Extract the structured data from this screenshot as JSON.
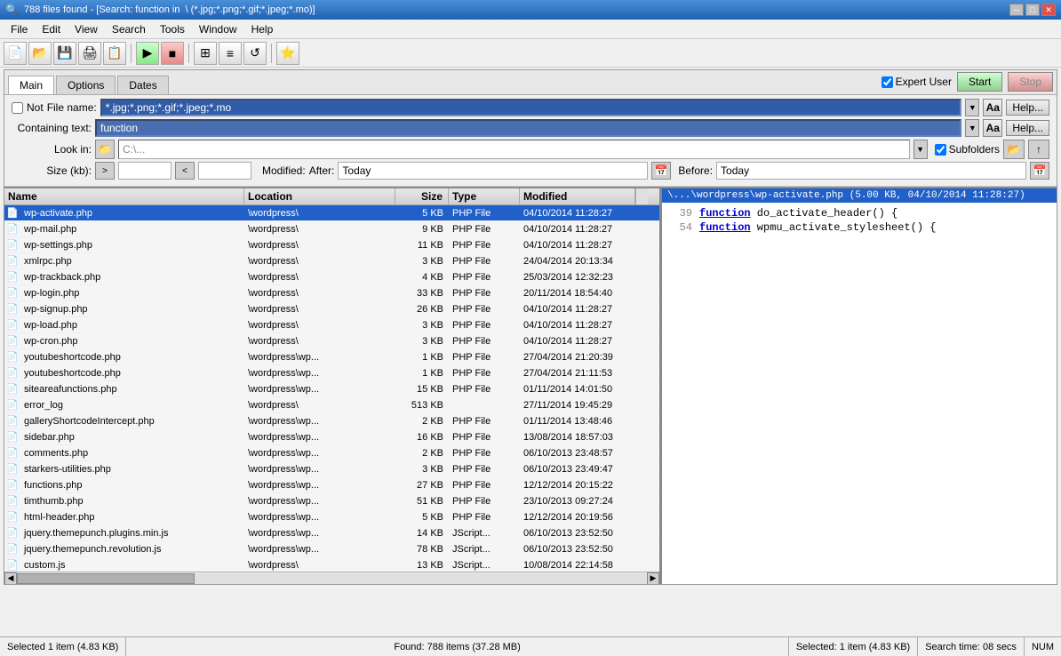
{
  "window": {
    "title": "788 files found - [Search: function in",
    "title_suffix": " \\ (*.jpg;*.png;*.gif;*.jpeg;*.mo)]"
  },
  "menu": {
    "items": [
      "File",
      "Edit",
      "View",
      "Search",
      "Tools",
      "Window",
      "Help"
    ]
  },
  "tabs": {
    "items": [
      "Main",
      "Options",
      "Dates"
    ],
    "active": "Main"
  },
  "header": {
    "expert_user_label": "Expert User",
    "start_label": "Start",
    "stop_label": "Stop"
  },
  "search_form": {
    "not_label": "Not",
    "file_name_label": "File name:",
    "file_name_value": "*.jpg;*.png;*.gif;*.jpeg;*.mo",
    "containing_label": "Containing text:",
    "containing_value": "function",
    "look_in_label": "Look in:",
    "look_in_value": "C:\\...",
    "subfolders_label": "Subfolders",
    "size_label": "Size (kb):",
    "size_from": "",
    "size_to": "",
    "modified_label": "Modified:",
    "after_label": "After:",
    "after_value": "Today",
    "before_label": "Before:",
    "before_value": "Today"
  },
  "file_list": {
    "columns": [
      "Name",
      "Location",
      "Size",
      "Type",
      "Modified"
    ],
    "rows": [
      {
        "name": "wp-activate.php",
        "location": "\\wordpress\\",
        "size": "5 KB",
        "type": "PHP File",
        "modified": "04/10/2014 11:28:27",
        "selected": true
      },
      {
        "name": "wp-mail.php",
        "location": "\\wordpress\\",
        "size": "9 KB",
        "type": "PHP File",
        "modified": "04/10/2014 11:28:27",
        "selected": false
      },
      {
        "name": "wp-settings.php",
        "location": "\\wordpress\\",
        "size": "11 KB",
        "type": "PHP File",
        "modified": "04/10/2014 11:28:27",
        "selected": false
      },
      {
        "name": "xmlrpc.php",
        "location": "\\wordpress\\",
        "size": "3 KB",
        "type": "PHP File",
        "modified": "24/04/2014 20:13:34",
        "selected": false
      },
      {
        "name": "wp-trackback.php",
        "location": "\\wordpress\\",
        "size": "4 KB",
        "type": "PHP File",
        "modified": "25/03/2014 12:32:23",
        "selected": false
      },
      {
        "name": "wp-login.php",
        "location": "\\wordpress\\",
        "size": "33 KB",
        "type": "PHP File",
        "modified": "20/11/2014 18:54:40",
        "selected": false
      },
      {
        "name": "wp-signup.php",
        "location": "\\wordpress\\",
        "size": "26 KB",
        "type": "PHP File",
        "modified": "04/10/2014 11:28:27",
        "selected": false
      },
      {
        "name": "wp-load.php",
        "location": "\\wordpress\\",
        "size": "3 KB",
        "type": "PHP File",
        "modified": "04/10/2014 11:28:27",
        "selected": false
      },
      {
        "name": "wp-cron.php",
        "location": "\\wordpress\\",
        "size": "3 KB",
        "type": "PHP File",
        "modified": "04/10/2014 11:28:27",
        "selected": false
      },
      {
        "name": "youtubeshortcode.php",
        "location": "\\wordpress\\wp...",
        "size": "1 KB",
        "type": "PHP File",
        "modified": "27/04/2014 21:20:39",
        "selected": false
      },
      {
        "name": "youtubeshortcode.php",
        "location": "\\wordpress\\wp...",
        "size": "1 KB",
        "type": "PHP File",
        "modified": "27/04/2014 21:11:53",
        "selected": false
      },
      {
        "name": "siteareafunctions.php",
        "location": "\\wordpress\\wp...",
        "size": "15 KB",
        "type": "PHP File",
        "modified": "01/11/2014 14:01:50",
        "selected": false
      },
      {
        "name": "error_log",
        "location": "\\wordpress\\",
        "size": "513 KB",
        "type": "",
        "modified": "27/11/2014 19:45:29",
        "selected": false
      },
      {
        "name": "galleryShortcodeIntercept.php",
        "location": "\\wordpress\\wp...",
        "size": "2 KB",
        "type": "PHP File",
        "modified": "01/11/2014 13:48:46",
        "selected": false
      },
      {
        "name": "sidebar.php",
        "location": "\\wordpress\\wp...",
        "size": "16 KB",
        "type": "PHP File",
        "modified": "13/08/2014 18:57:03",
        "selected": false
      },
      {
        "name": "comments.php",
        "location": "\\wordpress\\wp...",
        "size": "2 KB",
        "type": "PHP File",
        "modified": "06/10/2013 23:48:57",
        "selected": false
      },
      {
        "name": "starkers-utilities.php",
        "location": "\\wordpress\\wp...",
        "size": "3 KB",
        "type": "PHP File",
        "modified": "06/10/2013 23:49:47",
        "selected": false
      },
      {
        "name": "functions.php",
        "location": "\\wordpress\\wp...",
        "size": "27 KB",
        "type": "PHP File",
        "modified": "12/12/2014 20:15:22",
        "selected": false
      },
      {
        "name": "timthumb.php",
        "location": "\\wordpress\\wp...",
        "size": "51 KB",
        "type": "PHP File",
        "modified": "23/10/2013 09:27:24",
        "selected": false
      },
      {
        "name": "html-header.php",
        "location": "\\wordpress\\wp...",
        "size": "5 KB",
        "type": "PHP File",
        "modified": "12/12/2014 20:19:56",
        "selected": false
      },
      {
        "name": "jquery.themepunch.plugins.min.js",
        "location": "\\wordpress\\wp...",
        "size": "14 KB",
        "type": "JScript...",
        "modified": "06/10/2013 23:52:50",
        "selected": false
      },
      {
        "name": "jquery.themepunch.revolution.js",
        "location": "\\wordpress\\wp...",
        "size": "78 KB",
        "type": "JScript...",
        "modified": "06/10/2013 23:52:50",
        "selected": false
      },
      {
        "name": "custom.js",
        "location": "\\wordpress\\",
        "size": "13 KB",
        "type": "JScript...",
        "modified": "10/08/2014 22:14:58",
        "selected": false
      }
    ]
  },
  "preview": {
    "header": "\\...\\wordpress\\wp-activate.php  (5.00 KB,  04/10/2014 11:28:27)",
    "lines": [
      {
        "num": "39",
        "code": "function do_activate_header() {",
        "keyword_start": 0,
        "keyword": "function"
      },
      {
        "num": "54",
        "code": "function wpmu_activate_stylesheet() {",
        "keyword_start": 0,
        "keyword": "function"
      }
    ]
  },
  "status": {
    "left": "Selected 1 item (4.83 KB)",
    "center": "Found: 788 items (37.28 MB)",
    "right": "Selected: 1 item (4.83 KB)",
    "search_time": "Search time: 08 secs",
    "num": "NUM"
  }
}
